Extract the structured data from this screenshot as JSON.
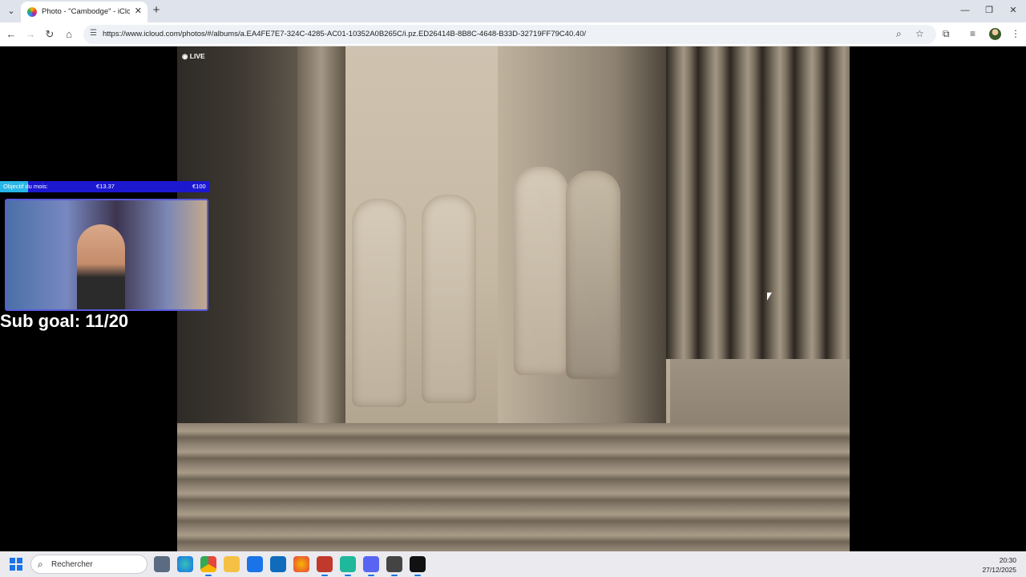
{
  "browser": {
    "tab": {
      "title": "Photo - \"Cambodge\" - iCloud P",
      "close": "✕"
    },
    "new_tab": "+",
    "window": {
      "minimize": "—",
      "maximize": "❐",
      "close": "✕"
    },
    "url": "https://www.icloud.com/photos/#/albums/a.EA4FE7E7-324C-4285-AC01-10352A0B265C/i.pz.ED26414B-8B8C-4648-B33D-32719FF79C40.40/"
  },
  "photo": {
    "live_label": "LIVE"
  },
  "stream_overlay": {
    "goal_label": "Objectif du mois:",
    "goal_current": "€13.37",
    "goal_target": "€100",
    "goal_progress": 0.134,
    "sub_goal": "Sub goal: 11/20"
  },
  "taskbar": {
    "search_placeholder": "Rechercher",
    "time": "20:30",
    "date": "27/12/2025"
  },
  "colors": {
    "accent": "#1a73e8",
    "goal_bar": "#1c18d0",
    "goal_fill": "#27b7e6"
  }
}
